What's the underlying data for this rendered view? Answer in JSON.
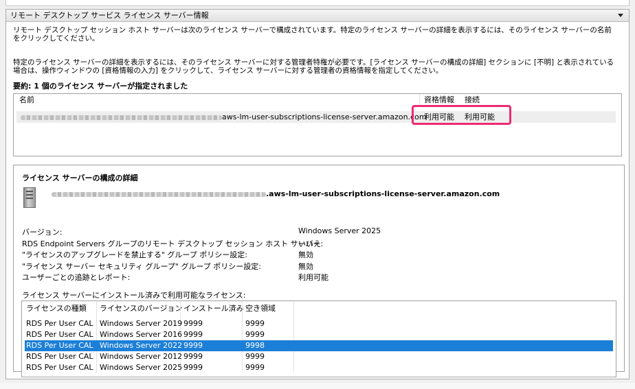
{
  "panel": {
    "title": "リモート デスクトップ サービス ライセンス サーバー情報",
    "para1": "リモート デスクトップ セッション ホスト サーバーは次のライセンス サーバーで構成されています。特定のライセンス サーバーの詳細を表示するには、そのライセンス サーバーの名前をクリックしてください。",
    "para2": "特定のライセンス サーバーの詳細を表示するには、そのライセンス サーバーに対する管理者特権が必要です。[ライセンス サーバーの構成の詳細] セクションに [不明] と表示されている場合は、操作ウィンドウの [資格情報の入力] をクリックして、ライセンス サーバーに対する管理者の資格情報を指定してください。",
    "summary": "要約: 1 個のライセンス サーバーが指定されました"
  },
  "server_list": {
    "headers": {
      "name": "名前",
      "credentials": "資格情報",
      "connection": "接続"
    },
    "rows": [
      {
        "name": "aws-lm-user-subscriptions-license-server.amazon.com",
        "credentials": "利用可能",
        "connection": "利用可能"
      }
    ]
  },
  "config": {
    "title": "ライセンス サーバーの構成の詳細",
    "server_name": ".aws-lm-user-subscriptions-license-server.amazon.com",
    "properties": [
      {
        "label": "バージョン:",
        "value": "Windows Server 2025"
      },
      {
        "label": "RDS Endpoint Servers グループのリモート デスクトップ セッション ホスト サーバー:",
        "value": "いいえ"
      },
      {
        "label": "\"ライセンスのアップグレードを禁止する\" グループ ポリシー設定:",
        "value": "無効"
      },
      {
        "label": "\"ライセンス サーバー セキュリティ グループ\" グループ ポリシー設定:",
        "value": "無効"
      },
      {
        "label": "ユーザーごとの追跡とレポート:",
        "value": "利用可能"
      }
    ],
    "licenses_label": "ライセンス サーバーにインストール済みで利用可能なライセンス:",
    "license_headers": {
      "type": "ライセンスの種類",
      "version": "ライセンスのバージョン",
      "installed": "インストール済み",
      "available": "空き領域"
    },
    "licenses": [
      {
        "type": "RDS Per User CAL",
        "version": "Windows Server 2019",
        "installed": "9999",
        "available": "9999",
        "selected": false
      },
      {
        "type": "RDS Per User CAL",
        "version": "Windows Server 2016",
        "installed": "9999",
        "available": "9999",
        "selected": false
      },
      {
        "type": "RDS Per User CAL",
        "version": "Windows Server 2022",
        "installed": "9999",
        "available": "9998",
        "selected": true
      },
      {
        "type": "RDS Per User CAL",
        "version": "Windows Server 2012",
        "installed": "9999",
        "available": "9999",
        "selected": false
      },
      {
        "type": "RDS Per User CAL",
        "version": "Windows Server 2025",
        "installed": "9999",
        "available": "9999",
        "selected": false
      }
    ]
  },
  "colors": {
    "selection": "#1c7fd7",
    "highlight_border": "#ee2a72"
  }
}
